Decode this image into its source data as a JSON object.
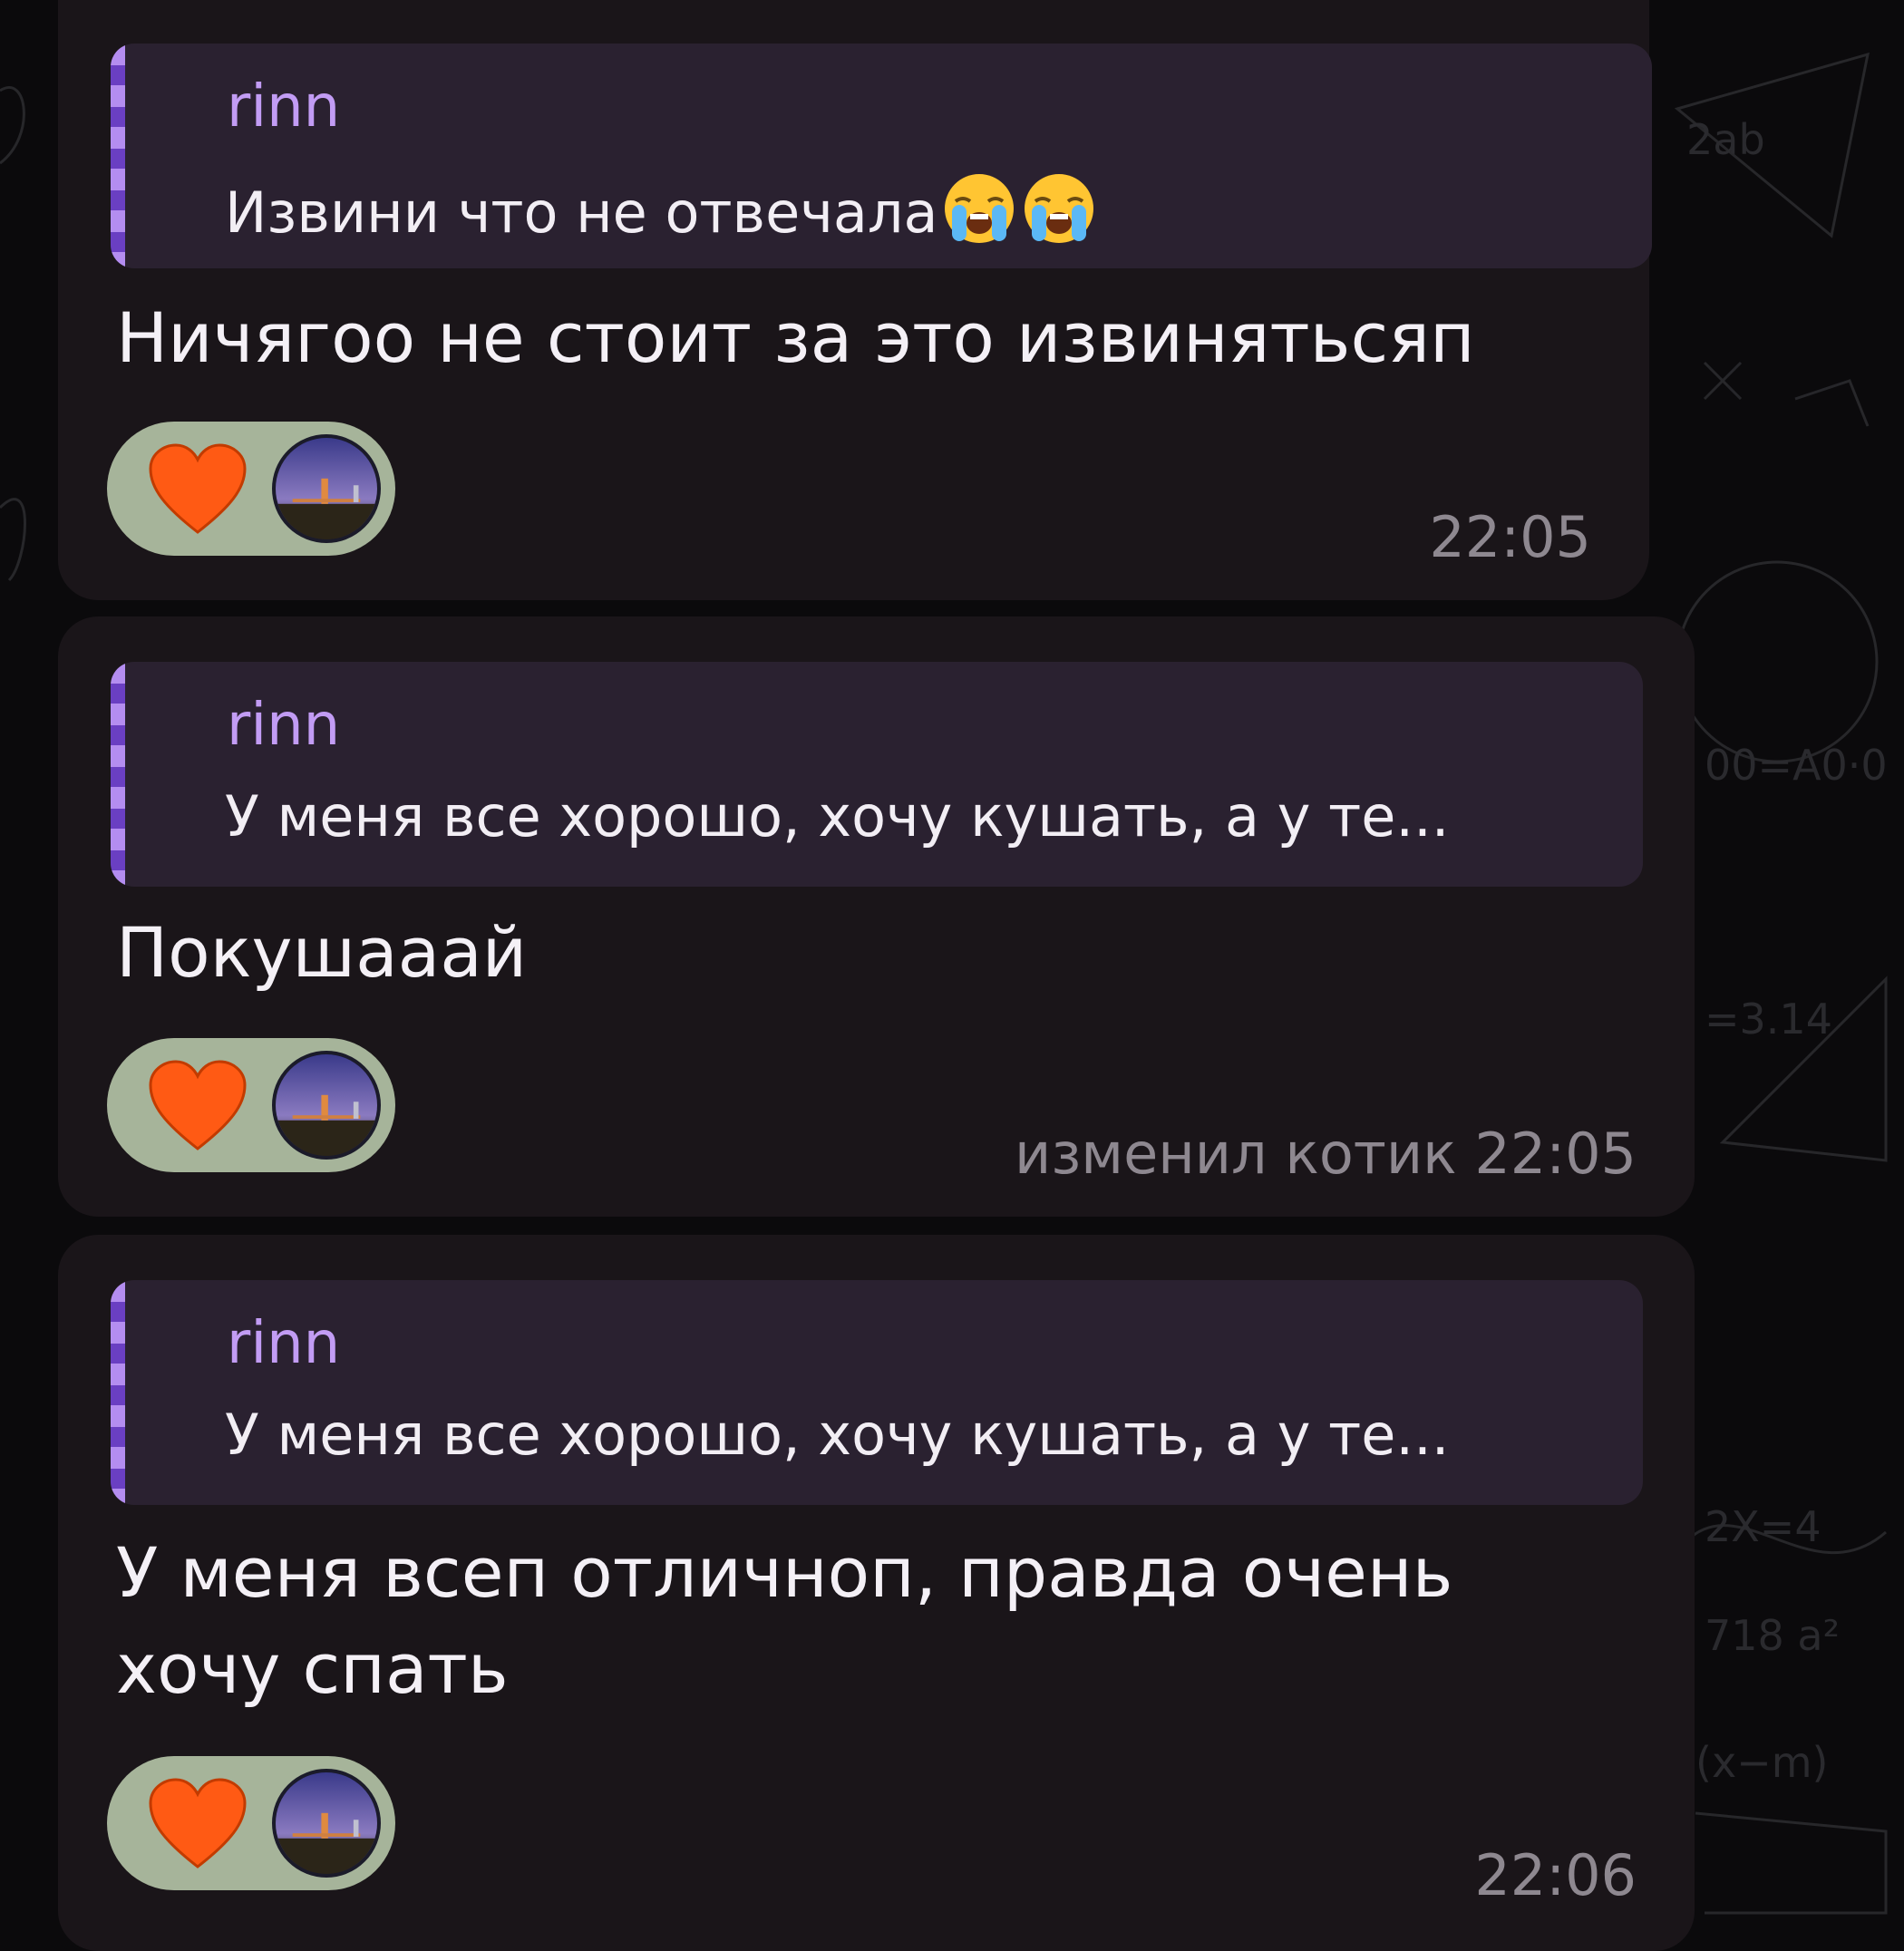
{
  "messages": [
    {
      "reply": {
        "author": "rinn",
        "text": "Извини что не отвечала",
        "emoji": "loudly-crying-face-icon"
      },
      "text_lines": [
        "Ничягоо не стоит за это извиняться"
      ],
      "text_suffix": "п",
      "reactions": [
        "heart-icon",
        "reactor-avatar"
      ],
      "meta": "22:05"
    },
    {
      "reply": {
        "author": "rinn",
        "text": "У меня все хорошо, хочу кушать, а у те..."
      },
      "text_lines": [
        "Покушааай"
      ],
      "reactions": [
        "heart-icon",
        "reactor-avatar"
      ],
      "meta": "изменил котик 22:05"
    },
    {
      "reply": {
        "author": "rinn",
        "text": "У меня все хорошо, хочу кушать, а у те..."
      },
      "text_lines": [
        "У меня всеп отличноп, правда очень",
        "хочу спать"
      ],
      "reactions": [
        "heart-icon",
        "reactor-avatar"
      ],
      "meta": "22:06"
    }
  ],
  "colors": {
    "bubble": "#1a1519",
    "reply_bg": "#2a2130",
    "reply_name": "#c29cf4",
    "reaction_bg": "#a6b49a",
    "heart": "#ff5a14",
    "time": "#8e8890"
  }
}
